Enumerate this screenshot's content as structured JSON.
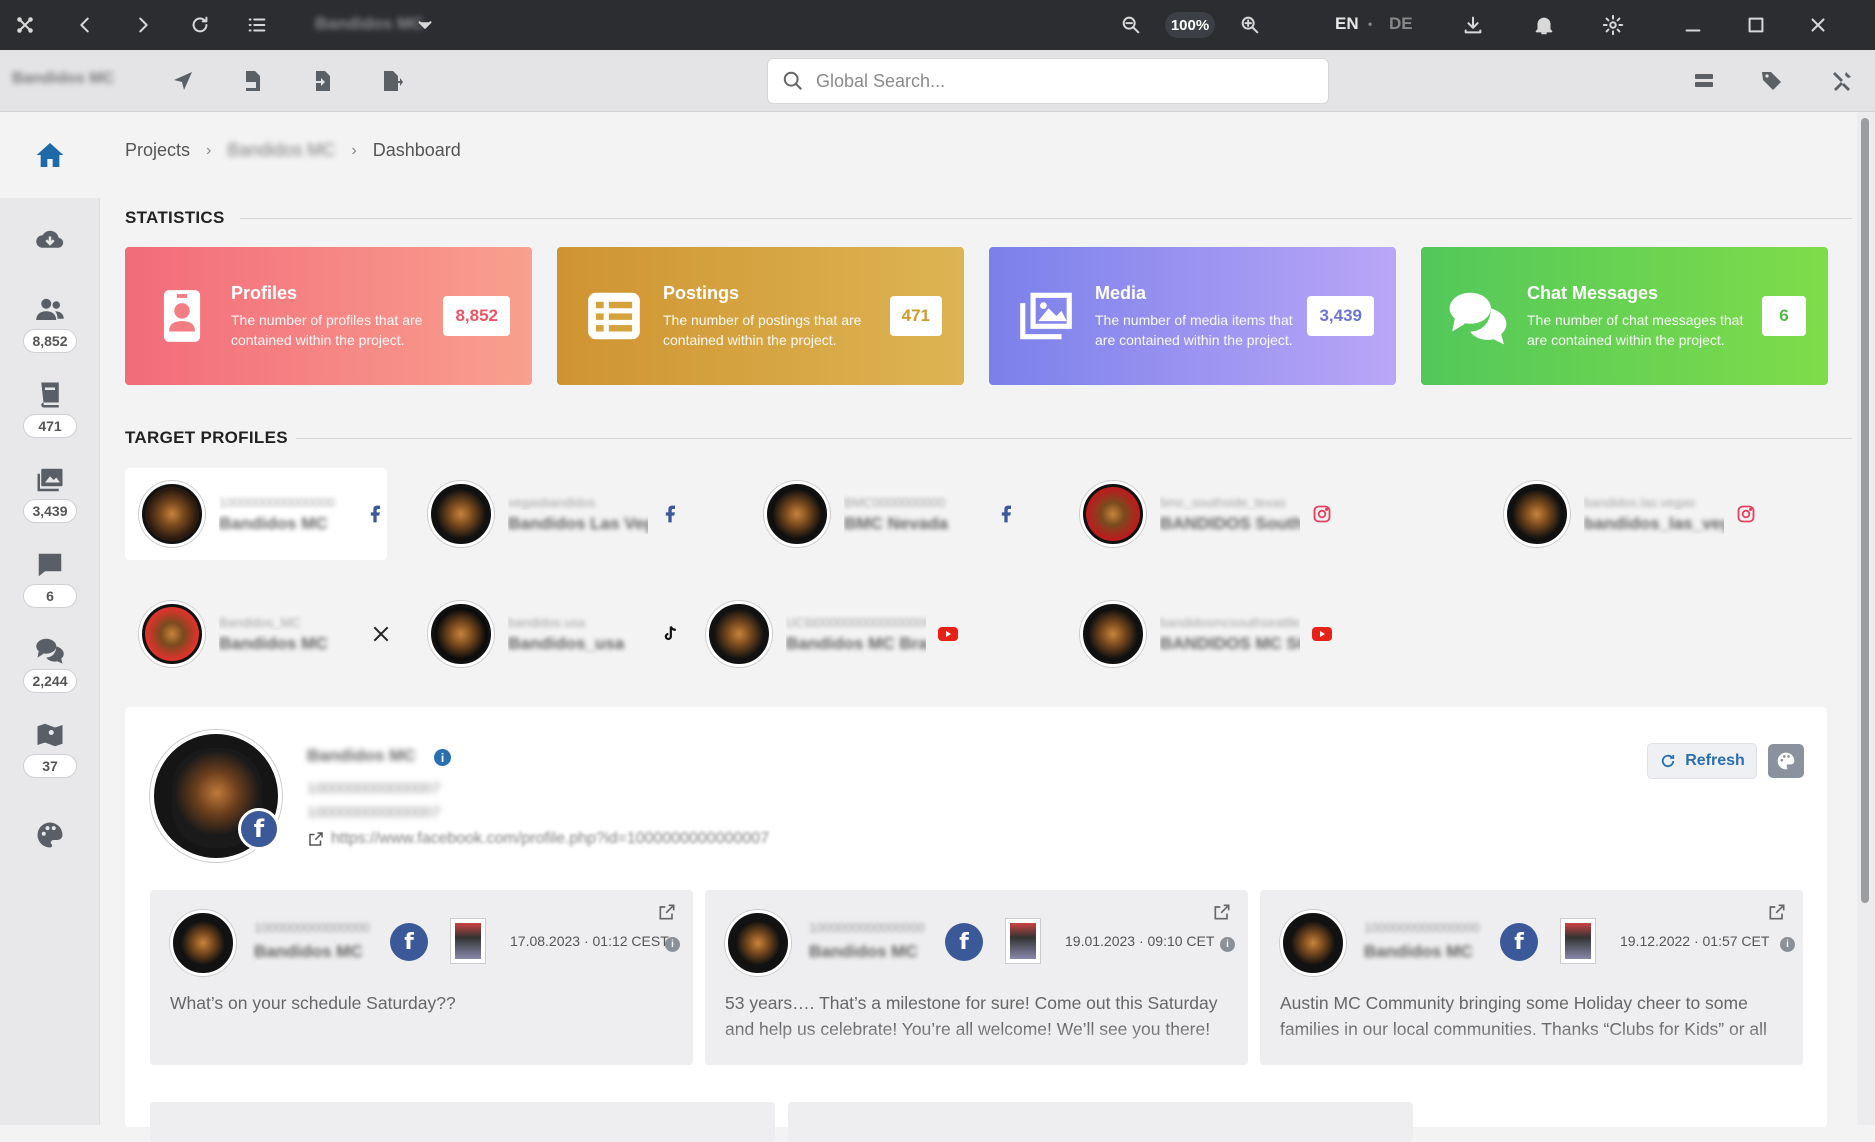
{
  "titlebar": {
    "project_name": "Bandidos MC",
    "zoom": "100%",
    "lang_en": "EN",
    "lang_sep": "•",
    "lang_de": "DE"
  },
  "toolbar": {
    "project_label": "Bandidos MC",
    "search_placeholder": "Global Search..."
  },
  "sidebar": {
    "profiles_count": "8,852",
    "postings_count": "471",
    "media_count": "3,439",
    "chats_count": "6",
    "comments_count": "2,244",
    "locations_count": "37"
  },
  "breadcrumb": {
    "projects": "Projects",
    "project": "Bandidos MC",
    "dashboard": "Dashboard"
  },
  "statistics": {
    "title": "STATISTICS",
    "cards": [
      {
        "title": "Profiles",
        "desc": "The number of profiles that are contained within the project.",
        "value": "8,852",
        "color": "#f27d84"
      },
      {
        "title": "Postings",
        "desc": "The number of postings that are contained within the project.",
        "value": "471",
        "color": "#d6a23c"
      },
      {
        "title": "Media",
        "desc": "The number of media items that are contained within the project.",
        "value": "3,439",
        "color": "#8c8ff0"
      },
      {
        "title": "Chat Messages",
        "desc": "The number of chat messages that are contained within the project.",
        "value": "6",
        "color": "#6ad15a"
      }
    ]
  },
  "target_profiles": {
    "title": "TARGET PROFILES",
    "items": [
      {
        "id": "1000000000000000",
        "name": "Bandidos MC",
        "network": "facebook"
      },
      {
        "id": "vegasbandidos",
        "name": "Bandidos Las Vegas",
        "network": "facebook"
      },
      {
        "id": "BMC0000000000",
        "name": "BMC Nevada",
        "network": "facebook"
      },
      {
        "id": "bmc_southside_texas",
        "name": "BANDIDOS Southside Texas",
        "network": "instagram"
      },
      {
        "id": "bandidos.las.vegas",
        "name": "bandidos_las_vegas",
        "network": "instagram"
      },
      {
        "id": "Bandidos_MC",
        "name": "Bandidos MC",
        "network": "x"
      },
      {
        "id": "bandidos.usa",
        "name": "Bandidos_usa",
        "network": "tiktok"
      },
      {
        "id": "UC6t0000000000000000",
        "name": "Bandidos MC Brazil",
        "network": "youtube"
      },
      {
        "id": "bandidosmcsouthseattle",
        "name": "BANDIDOS MC SOUTH SEATTLE",
        "network": "youtube"
      }
    ]
  },
  "profile": {
    "name": "Bandidos MC",
    "id1": "1000000000000007",
    "id2": "1000000000000007",
    "url": "https://www.facebook.com/profile.php?id=1000000000000007",
    "refresh_label": "Refresh"
  },
  "posts": [
    {
      "id": "1000000000000000",
      "name": "Bandidos MC",
      "date": "17.08.2023 · 01:12 CEST",
      "text": "What’s on your schedule Saturday??"
    },
    {
      "id": "1000000000000000",
      "name": "Bandidos MC",
      "date": "19.01.2023 · 09:10 CET",
      "text": "53 years…. That’s a milestone for sure! Come out this Saturday and help us celebrate! You’re all welcome! We’ll see you there!"
    },
    {
      "id": "1000000000000000",
      "name": "Bandidos MC",
      "date": "19.12.2022 · 01:57 CET",
      "text": "Austin MC Community bringing some Holiday cheer to some families in our local communities. Thanks “Clubs for Kids” or all"
    }
  ]
}
